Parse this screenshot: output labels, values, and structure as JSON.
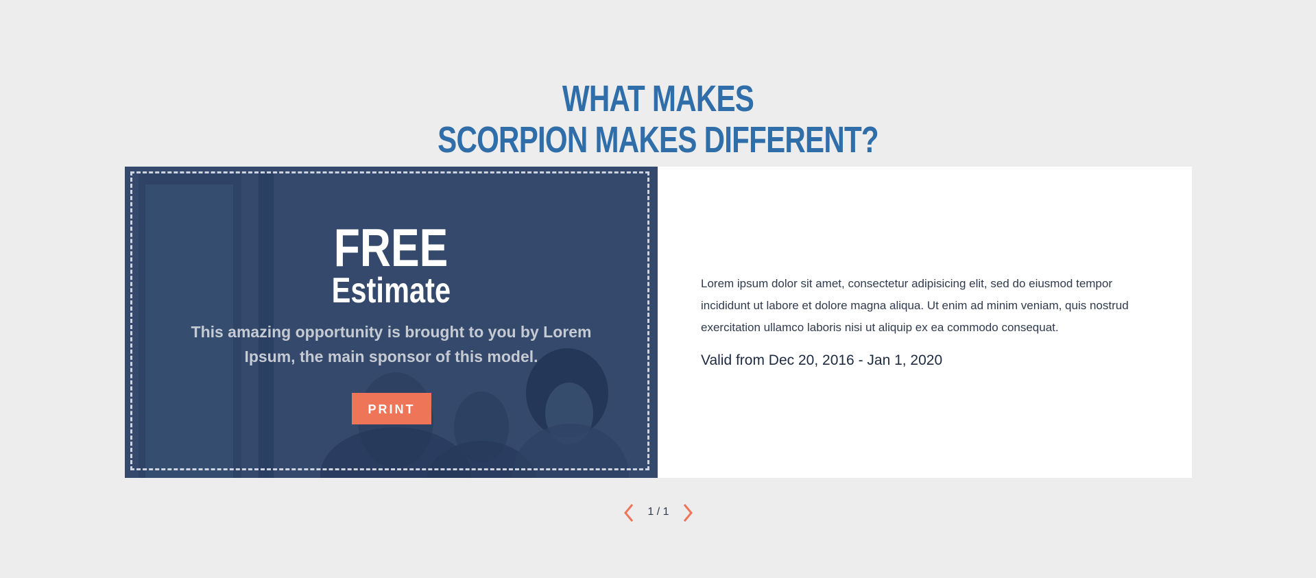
{
  "heading": {
    "line1": "WHAT MAKES",
    "line2": "SCORPION MAKES DIFFERENT?"
  },
  "promo": {
    "title": "FREE",
    "subtitle": "Estimate",
    "description": "This amazing opportunity is brought to you by Lorem Ipsum, the main sponsor of this model.",
    "button_label": "PRINT"
  },
  "details": {
    "text": "Lorem ipsum dolor sit amet, consectetur adipisicing elit, sed do eiusmod tempor incididunt ut labore et dolore magna aliqua. Ut enim ad minim veniam, quis nostrud exercitation ullamco laboris nisi ut aliquip ex ea commodo consequat.",
    "valid": "Valid from Dec 20, 2016 - Jan 1, 2020"
  },
  "pager": {
    "count": "1 / 1"
  },
  "colors": {
    "heading": "#2f6ea9",
    "accent": "#ef7558",
    "promo_bg": "#3a5476",
    "page_bg": "#ededed"
  },
  "icons": {
    "prev": "chevron-left-icon",
    "next": "chevron-right-icon"
  }
}
